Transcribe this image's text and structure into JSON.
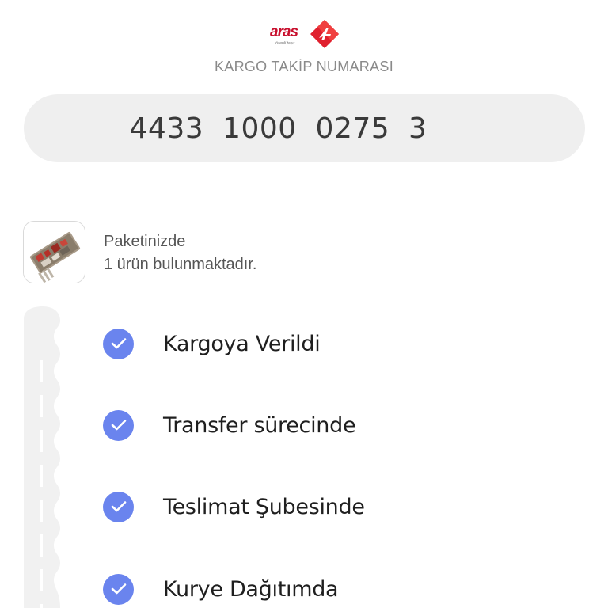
{
  "brand": {
    "logo_text": "aras",
    "tagline": "özenli taşır..",
    "logo_icon": "aras-logo-diamond-icon",
    "colors": {
      "red": "#e0202e",
      "dark_red": "#c8102e"
    }
  },
  "tracking": {
    "heading": "KARGO TAKİP NUMARASI",
    "number": "4433  1000  0275  3"
  },
  "package": {
    "thumbnail_icon": "product-image",
    "line1": "Paketinizde",
    "line2": "1 ürün bulunmaktadır."
  },
  "statuses": [
    {
      "label": "Kargoya Verildi",
      "icon": "check-icon",
      "completed": true
    },
    {
      "label": "Transfer sürecinde",
      "icon": "check-icon",
      "completed": true
    },
    {
      "label": "Teslimat Şubesinde",
      "icon": "check-icon",
      "completed": true
    },
    {
      "label": "Kurye Dağıtımda",
      "icon": "check-icon",
      "completed": true
    }
  ],
  "colors": {
    "accent": "#6a84ee",
    "pill_bg": "#efefef",
    "heading": "#8a8a8a",
    "text": "#1f1f1f"
  }
}
